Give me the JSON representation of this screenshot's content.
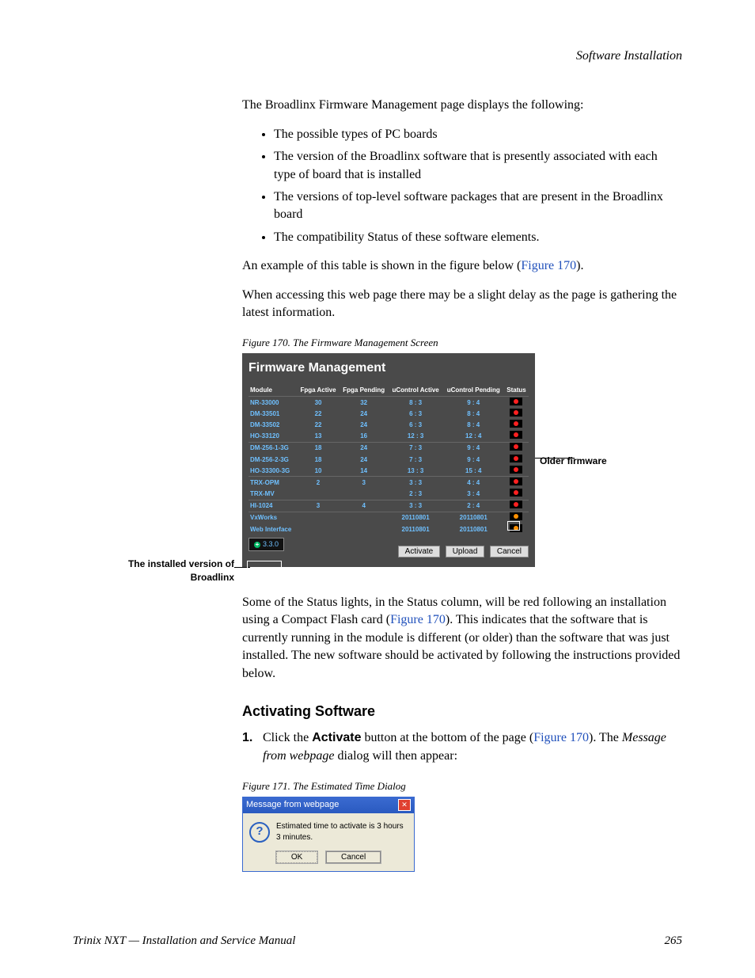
{
  "running_head": "Software Installation",
  "intro": "The Broadlinx Firmware Management page displays the following:",
  "bullets": [
    "The possible types of PC boards",
    "The version of the Broadlinx software that is presently associated with each type of board that is installed",
    "The versions of top-level software packages that are present in the Broadlinx board",
    "The compatibility Status of these software elements."
  ],
  "example_line_pre": "An example of this table is shown in the figure below (",
  "example_link": "Figure 170",
  "example_line_post": ").",
  "delay_para": "When accessing this web page there may be a slight delay as the page is gathering the latest information.",
  "fig170_caption": "Figure 170.  The Firmware Management Screen",
  "fw": {
    "title": "Firmware Management",
    "headers": [
      "Module",
      "Fpga Active",
      "Fpga Pending",
      "uControl Active",
      "uControl Pending",
      "Status"
    ],
    "rows": [
      {
        "m": "NR-33000",
        "fa": "30",
        "fp": "32",
        "ua": "8 : 3",
        "up": "9 : 4",
        "s": "red",
        "sep": false
      },
      {
        "m": "DM-33501",
        "fa": "22",
        "fp": "24",
        "ua": "6 : 3",
        "up": "8 : 4",
        "s": "red",
        "sep": false
      },
      {
        "m": "DM-33502",
        "fa": "22",
        "fp": "24",
        "ua": "6 : 3",
        "up": "8 : 4",
        "s": "red",
        "sep": false
      },
      {
        "m": "HO-33120",
        "fa": "13",
        "fp": "16",
        "ua": "12 : 3",
        "up": "12 : 4",
        "s": "red",
        "sep": true
      },
      {
        "m": "DM-256-1-3G",
        "fa": "18",
        "fp": "24",
        "ua": "7 : 3",
        "up": "9 : 4",
        "s": "red",
        "sep": false
      },
      {
        "m": "DM-256-2-3G",
        "fa": "18",
        "fp": "24",
        "ua": "7 : 3",
        "up": "9 : 4",
        "s": "red",
        "sep": false
      },
      {
        "m": "HO-33300-3G",
        "fa": "10",
        "fp": "14",
        "ua": "13 : 3",
        "up": "15 : 4",
        "s": "red",
        "sep": true
      },
      {
        "m": "TRX-OPM",
        "fa": "2",
        "fp": "3",
        "ua": "3 : 3",
        "up": "4 : 4",
        "s": "red",
        "sep": false
      },
      {
        "m": "TRX-MV",
        "fa": "",
        "fp": "",
        "ua": "2 : 3",
        "up": "3 : 4",
        "s": "red",
        "sep": true
      },
      {
        "m": "HI-1024",
        "fa": "3",
        "fp": "4",
        "ua": "3 : 3",
        "up": "2 : 4",
        "s": "red",
        "sep": true
      },
      {
        "m": "VxWorks",
        "fa": "",
        "fp": "",
        "ua": "20110801",
        "up": "20110801",
        "s": "orange",
        "sep": false
      },
      {
        "m": "Web Interface",
        "fa": "",
        "fp": "",
        "ua": "20110801",
        "up": "20110801",
        "s": "orange",
        "sep": false
      }
    ],
    "version": "3.3.0",
    "buttons": {
      "activate": "Activate",
      "upload": "Upload",
      "cancel": "Cancel"
    }
  },
  "callouts": {
    "left": "The installed version of Broadlinx",
    "right": "Older firmware"
  },
  "status_para_1": "Some of the Status lights, in the Status column, will be red following an installation using a Compact Flash card (",
  "status_link": "Figure 170",
  "status_para_2": "). This indicates that the software that is currently running in the module is different (or older) than the software that was just installed. The new software should be activated by following the instructions provided below.",
  "h3": "Activating Software",
  "step1_pre": "Click the ",
  "step1_bold": "Activate",
  "step1_mid": " button at the bottom of the page (",
  "step1_link": "Figure 170",
  "step1_post": "). The ",
  "step1_ital": "Message from webpage",
  "step1_end": " dialog will then appear:",
  "step1_num": "1.",
  "fig171_caption": "Figure 171.  The Estimated Time Dialog",
  "dialog": {
    "title": "Message from webpage",
    "body": "Estimated time to activate is 3 hours 3 minutes.",
    "ok": "OK",
    "cancel": "Cancel"
  },
  "footer": {
    "left": "Trinix NXT  —  Installation and Service Manual",
    "page": "265"
  }
}
